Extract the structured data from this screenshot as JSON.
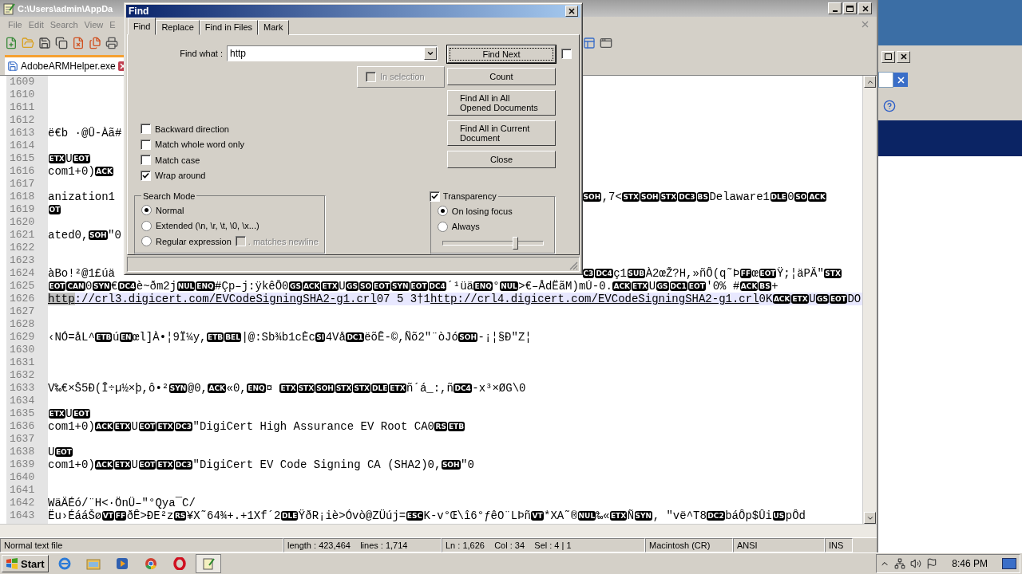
{
  "editor_window": {
    "title": "C:\\Users\\admin\\AppDa",
    "menu": [
      "File",
      "Edit",
      "Search",
      "View",
      "E"
    ],
    "document_tab": {
      "label": "AdobeARMHelper.exe",
      "selected": true
    }
  },
  "lines": [
    {
      "number": "1609",
      "current": false
    },
    {
      "number": "1610",
      "current": false
    },
    {
      "number": "1611",
      "current": false
    },
    {
      "number": "1612",
      "current": false
    },
    {
      "number": "1613",
      "current": false,
      "segments": [
        {
          "kind": "plain",
          "text": "ë€b ·@Û-Àã#"
        }
      ]
    },
    {
      "number": "1614",
      "current": false
    },
    {
      "number": "1615",
      "current": false,
      "segments": [
        {
          "kind": "ctrl",
          "text": "ETX"
        },
        {
          "kind": "plain",
          "text": "U"
        },
        {
          "kind": "ctrl",
          "text": "EOT"
        }
      ]
    },
    {
      "number": "1616",
      "current": false,
      "segments": [
        {
          "kind": "plain",
          "text": "com1+0)"
        },
        {
          "kind": "ctrl",
          "text": "ACK"
        }
      ]
    },
    {
      "number": "1617",
      "current": false
    },
    {
      "number": "1618",
      "current": false,
      "segments": [
        {
          "kind": "plain",
          "text": "anization1"
        }
      ],
      "right": [
        {
          "kind": "ctrl",
          "text": "SOH"
        },
        {
          "kind": "plain",
          "text": ",7<"
        },
        {
          "kind": "ctrl",
          "text": "STX"
        },
        {
          "kind": "ctrl",
          "text": "SOH"
        },
        {
          "kind": "ctrl",
          "text": "STX"
        },
        {
          "kind": "ctrl",
          "text": "DC3"
        },
        {
          "kind": "ctrl",
          "text": "BS"
        },
        {
          "kind": "plain",
          "text": "Delaware1"
        },
        {
          "kind": "ctrl",
          "text": "DLE"
        },
        {
          "kind": "plain",
          "text": "0"
        },
        {
          "kind": "ctrl",
          "text": "SO"
        },
        {
          "kind": "ctrl",
          "text": "ACK"
        }
      ]
    },
    {
      "number": "1619",
      "current": false,
      "segments": [
        {
          "kind": "ctrl",
          "text": "OT"
        }
      ]
    },
    {
      "number": "1620",
      "current": false
    },
    {
      "number": "1621",
      "current": false,
      "segments": [
        {
          "kind": "plain",
          "text": "ated0,"
        },
        {
          "kind": "ctrl",
          "text": "SOH"
        },
        {
          "kind": "plain",
          "text": "\"0"
        }
      ]
    },
    {
      "number": "1622",
      "current": false
    },
    {
      "number": "1623",
      "current": false
    },
    {
      "number": "1624",
      "current": false,
      "segments": [
        {
          "kind": "plain",
          "text": "àBo!²@1£úä"
        }
      ],
      "right": [
        {
          "kind": "ctrl",
          "text": "C3"
        },
        {
          "kind": "ctrl",
          "text": "DC4"
        },
        {
          "kind": "plain",
          "text": "ç1"
        },
        {
          "kind": "ctrl",
          "text": "SUB"
        },
        {
          "kind": "plain",
          "text": "À2œŽ?H,»ñÔ(q˜Þ"
        },
        {
          "kind": "ctrl",
          "text": "FF"
        },
        {
          "kind": "plain",
          "text": "œ"
        },
        {
          "kind": "ctrl",
          "text": "EOT"
        },
        {
          "kind": "plain",
          "text": "Ÿ;¦äPÄ\""
        },
        {
          "kind": "ctrl",
          "text": "STX"
        }
      ]
    },
    {
      "number": "1625",
      "current": false,
      "segments": [
        {
          "kind": "ctrl",
          "text": "EOT"
        },
        {
          "kind": "ctrl",
          "text": "CAN"
        },
        {
          "kind": "plain",
          "text": "0"
        },
        {
          "kind": "ctrl",
          "text": "SYN"
        },
        {
          "kind": "plain",
          "text": "€"
        },
        {
          "kind": "ctrl",
          "text": "DC4"
        },
        {
          "kind": "plain",
          "text": "è~ðm2j"
        },
        {
          "kind": "ctrl",
          "text": "NUL"
        },
        {
          "kind": "ctrl",
          "text": "ENQ"
        },
        {
          "kind": "plain",
          "text": "#Çp–j:ÿkêÔ0"
        },
        {
          "kind": "ctrl",
          "text": "GS"
        },
        {
          "kind": "ctrl",
          "text": "ACK"
        },
        {
          "kind": "ctrl",
          "text": "ETX"
        },
        {
          "kind": "plain",
          "text": "U"
        },
        {
          "kind": "ctrl",
          "text": "GS"
        },
        {
          "kind": "ctrl",
          "text": "SO"
        },
        {
          "kind": "ctrl",
          "text": "EOT"
        },
        {
          "kind": "ctrl",
          "text": "SYN"
        },
        {
          "kind": "ctrl",
          "text": "EOT"
        },
        {
          "kind": "ctrl",
          "text": "DC4"
        },
        {
          "kind": "plain",
          "text": "´¹üä"
        },
        {
          "kind": "ctrl",
          "text": "ENQ"
        },
        {
          "kind": "plain",
          "text": "°"
        },
        {
          "kind": "ctrl",
          "text": "NUL"
        },
        {
          "kind": "plain",
          "text": ">€–ÅdËãM)mÚ-0."
        },
        {
          "kind": "ctrl",
          "text": "ACK"
        },
        {
          "kind": "ctrl",
          "text": "ETX"
        },
        {
          "kind": "plain",
          "text": "U"
        },
        {
          "kind": "ctrl",
          "text": "GS"
        },
        {
          "kind": "ctrl",
          "text": "DC1"
        },
        {
          "kind": "ctrl",
          "text": "EOT"
        },
        {
          "kind": "plain",
          "text": "'0% #"
        },
        {
          "kind": "ctrl",
          "text": "ACK"
        },
        {
          "kind": "ctrl",
          "text": "BS"
        },
        {
          "kind": "plain",
          "text": "+"
        }
      ]
    },
    {
      "number": "1626",
      "current": true,
      "segments": [
        {
          "kind": "match",
          "text": "http"
        },
        {
          "kind": "link",
          "text": "://crl3.digicert.com/EVCodeSigningSHA2-g1.crl"
        },
        {
          "kind": "plain",
          "text": "07 5 3†1"
        },
        {
          "kind": "link",
          "text": "http://crl4.digicert.com/EVCodeSigningSHA2-g1.crl"
        },
        {
          "kind": "plain",
          "text": "0K"
        },
        {
          "kind": "ctrl",
          "text": "ACK"
        },
        {
          "kind": "ctrl",
          "text": "ETX"
        },
        {
          "kind": "plain",
          "text": "U"
        },
        {
          "kind": "ctrl",
          "text": "GS"
        },
        {
          "kind": "ctrl",
          "text": "EOT"
        },
        {
          "kind": "plain",
          "text": "DO"
        }
      ]
    },
    {
      "number": "1627",
      "current": false
    },
    {
      "number": "1628",
      "current": false
    },
    {
      "number": "1629",
      "current": false,
      "segments": [
        {
          "kind": "plain",
          "text": "‹NÓ=åL^"
        },
        {
          "kind": "ctrl",
          "text": "ETB"
        },
        {
          "kind": "plain",
          "text": "ú"
        },
        {
          "kind": "ctrl",
          "text": "EN"
        },
        {
          "kind": "plain",
          "text": "œl]À•¦9Ï¼y,"
        },
        {
          "kind": "ctrl",
          "text": "ETB"
        },
        {
          "kind": "ctrl",
          "text": "BEL"
        },
        {
          "kind": "plain",
          "text": "|@:Sb¾b1cÈc"
        },
        {
          "kind": "ctrl",
          "text": "SI"
        },
        {
          "kind": "plain",
          "text": "4Vå"
        },
        {
          "kind": "ctrl",
          "text": "DC1"
        },
        {
          "kind": "plain",
          "text": "ëõÊ-©,Ñõ2″¨òJó"
        },
        {
          "kind": "ctrl",
          "text": "SOH"
        },
        {
          "kind": "plain",
          "text": "-¡¦§Ð\"Z¦"
        }
      ]
    },
    {
      "number": "1630",
      "current": false
    },
    {
      "number": "1631",
      "current": false
    },
    {
      "number": "1632",
      "current": false
    },
    {
      "number": "1633",
      "current": false,
      "segments": [
        {
          "kind": "plain",
          "text": "V‰€×Š5Ð(Î÷µ½×þ,ô•²"
        },
        {
          "kind": "ctrl",
          "text": "SYN"
        },
        {
          "kind": "plain",
          "text": "@0,"
        },
        {
          "kind": "ctrl",
          "text": "ACK"
        },
        {
          "kind": "plain",
          "text": "«0,"
        },
        {
          "kind": "ctrl",
          "text": "ENQ"
        },
        {
          "kind": "plain",
          "text": "¤ "
        },
        {
          "kind": "ctrl",
          "text": "ETX"
        },
        {
          "kind": "ctrl",
          "text": "STX"
        },
        {
          "kind": "ctrl",
          "text": "SOH"
        },
        {
          "kind": "ctrl",
          "text": "STX"
        },
        {
          "kind": "ctrl",
          "text": "STX"
        },
        {
          "kind": "ctrl",
          "text": "DLE"
        },
        {
          "kind": "ctrl",
          "text": "ETX"
        },
        {
          "kind": "plain",
          "text": "ñ´á_:,ñ"
        },
        {
          "kind": "ctrl",
          "text": "DC4"
        },
        {
          "kind": "plain",
          "text": "-x³×ØG\\0"
        }
      ]
    },
    {
      "number": "1634",
      "current": false
    },
    {
      "number": "1635",
      "current": false,
      "segments": [
        {
          "kind": "ctrl",
          "text": "ETX"
        },
        {
          "kind": "plain",
          "text": "U"
        },
        {
          "kind": "ctrl",
          "text": "EOT"
        }
      ]
    },
    {
      "number": "1636",
      "current": false,
      "segments": [
        {
          "kind": "plain",
          "text": "com1+0)"
        },
        {
          "kind": "ctrl",
          "text": "ACK"
        },
        {
          "kind": "ctrl",
          "text": "ETX"
        },
        {
          "kind": "plain",
          "text": "U"
        },
        {
          "kind": "ctrl",
          "text": "EOT"
        },
        {
          "kind": "ctrl",
          "text": "ETX"
        },
        {
          "kind": "ctrl",
          "text": "DC3"
        },
        {
          "kind": "plain",
          "text": "\"DigiCert High Assurance EV Root CA0"
        },
        {
          "kind": "ctrl",
          "text": "RS"
        },
        {
          "kind": "ctrl",
          "text": "ETB"
        }
      ]
    },
    {
      "number": "1637",
      "current": false
    },
    {
      "number": "1638",
      "current": false,
      "segments": [
        {
          "kind": "plain",
          "text": "U"
        },
        {
          "kind": "ctrl",
          "text": "EOT"
        }
      ]
    },
    {
      "number": "1639",
      "current": false,
      "segments": [
        {
          "kind": "plain",
          "text": "com1+0)"
        },
        {
          "kind": "ctrl",
          "text": "ACK"
        },
        {
          "kind": "ctrl",
          "text": "ETX"
        },
        {
          "kind": "plain",
          "text": "U"
        },
        {
          "kind": "ctrl",
          "text": "EOT"
        },
        {
          "kind": "ctrl",
          "text": "ETX"
        },
        {
          "kind": "ctrl",
          "text": "DC3"
        },
        {
          "kind": "plain",
          "text": "\"DigiCert EV Code Signing CA (SHA2)0,"
        },
        {
          "kind": "ctrl",
          "text": "SOH"
        },
        {
          "kind": "plain",
          "text": "\"0"
        }
      ]
    },
    {
      "number": "1640",
      "current": false
    },
    {
      "number": "1641",
      "current": false
    },
    {
      "number": "1642",
      "current": false,
      "segments": [
        {
          "kind": "plain",
          "text": "WäÄÉó/¨H<·ÖnÜ–″°Qya¯C/"
        }
      ]
    },
    {
      "number": "1643",
      "current": false,
      "segments": [
        {
          "kind": "plain",
          "text": "Ëu›ÉááŠø"
        },
        {
          "kind": "ctrl",
          "text": "VT"
        },
        {
          "kind": "ctrl",
          "text": "FF"
        },
        {
          "kind": "plain",
          "text": "ðÊ>ÐE²z"
        },
        {
          "kind": "ctrl",
          "text": "RS"
        },
        {
          "kind": "plain",
          "text": "¥X˜64¾+.+1Xf´2"
        },
        {
          "kind": "ctrl",
          "text": "DLE"
        },
        {
          "kind": "plain",
          "text": "ŸðR¡iè>Óvò@ZÜúj="
        },
        {
          "kind": "ctrl",
          "text": "ESC"
        },
        {
          "kind": "plain",
          "text": "K-v°Œ\\î6°ƒêO¨LÞñ"
        },
        {
          "kind": "ctrl",
          "text": "VT"
        },
        {
          "kind": "plain",
          "text": "*XA˜®"
        },
        {
          "kind": "ctrl",
          "text": "NUL"
        },
        {
          "kind": "plain",
          "text": "‰«"
        },
        {
          "kind": "ctrl",
          "text": "ETX"
        },
        {
          "kind": "plain",
          "text": "Ñ"
        },
        {
          "kind": "ctrl",
          "text": "SYN"
        },
        {
          "kind": "plain",
          "text": ", \"vë^T8"
        },
        {
          "kind": "ctrl",
          "text": "DC2"
        },
        {
          "kind": "plain",
          "text": "báÔp$Ûi"
        },
        {
          "kind": "ctrl",
          "text": "US"
        },
        {
          "kind": "plain",
          "text": "pÔd"
        }
      ]
    }
  ],
  "find_dialog": {
    "title": "Find",
    "tabs": [
      {
        "label": "Find",
        "selected": true
      },
      {
        "label": "Replace",
        "selected": false
      },
      {
        "label": "Find in Files",
        "selected": false
      },
      {
        "label": "Mark",
        "selected": false
      }
    ],
    "find_what": {
      "label": "Find what :",
      "value": "http"
    },
    "find_next_option": {
      "checked": false
    },
    "in_selection": {
      "label": "In selection",
      "checked": false,
      "disabled": true
    },
    "buttons": [
      {
        "label": "Find Next",
        "focused": true
      },
      {
        "label": "Count",
        "focused": false
      },
      {
        "label": "Find All in All Opened Documents",
        "focused": false
      },
      {
        "label": "Find All in Current Document",
        "focused": false
      },
      {
        "label": "Close",
        "focused": false
      }
    ],
    "options": [
      {
        "label": "Backward direction",
        "checked": false
      },
      {
        "label": "Match whole word only",
        "checked": false
      },
      {
        "label": "Match case",
        "checked": false
      },
      {
        "label": "Wrap around",
        "checked": true
      }
    ],
    "search_mode": {
      "title": "Search Mode",
      "modes": [
        {
          "label": "Normal",
          "selected": true
        },
        {
          "label": "Extended (\\n, \\r, \\t, \\0, \\x...)",
          "selected": false
        },
        {
          "label": "Regular expression",
          "selected": false
        }
      ],
      "matches_newline": {
        "label": ". matches newline",
        "checked": false,
        "disabled": true
      }
    },
    "transparency": {
      "label": "Transparency",
      "checked": true,
      "modes": [
        {
          "label": "On losing focus",
          "selected": true
        },
        {
          "label": "Always",
          "selected": false
        }
      ],
      "level": 0.72
    }
  },
  "status_bar": [
    "Normal text file",
    "length : 423,464    lines : 1,714",
    "Ln : 1,626    Col : 34    Sel : 4 | 1",
    "Macintosh (CR)",
    "ANSI",
    "INS"
  ],
  "taskbar": {
    "start": "Start",
    "clock": "8:46 PM"
  }
}
